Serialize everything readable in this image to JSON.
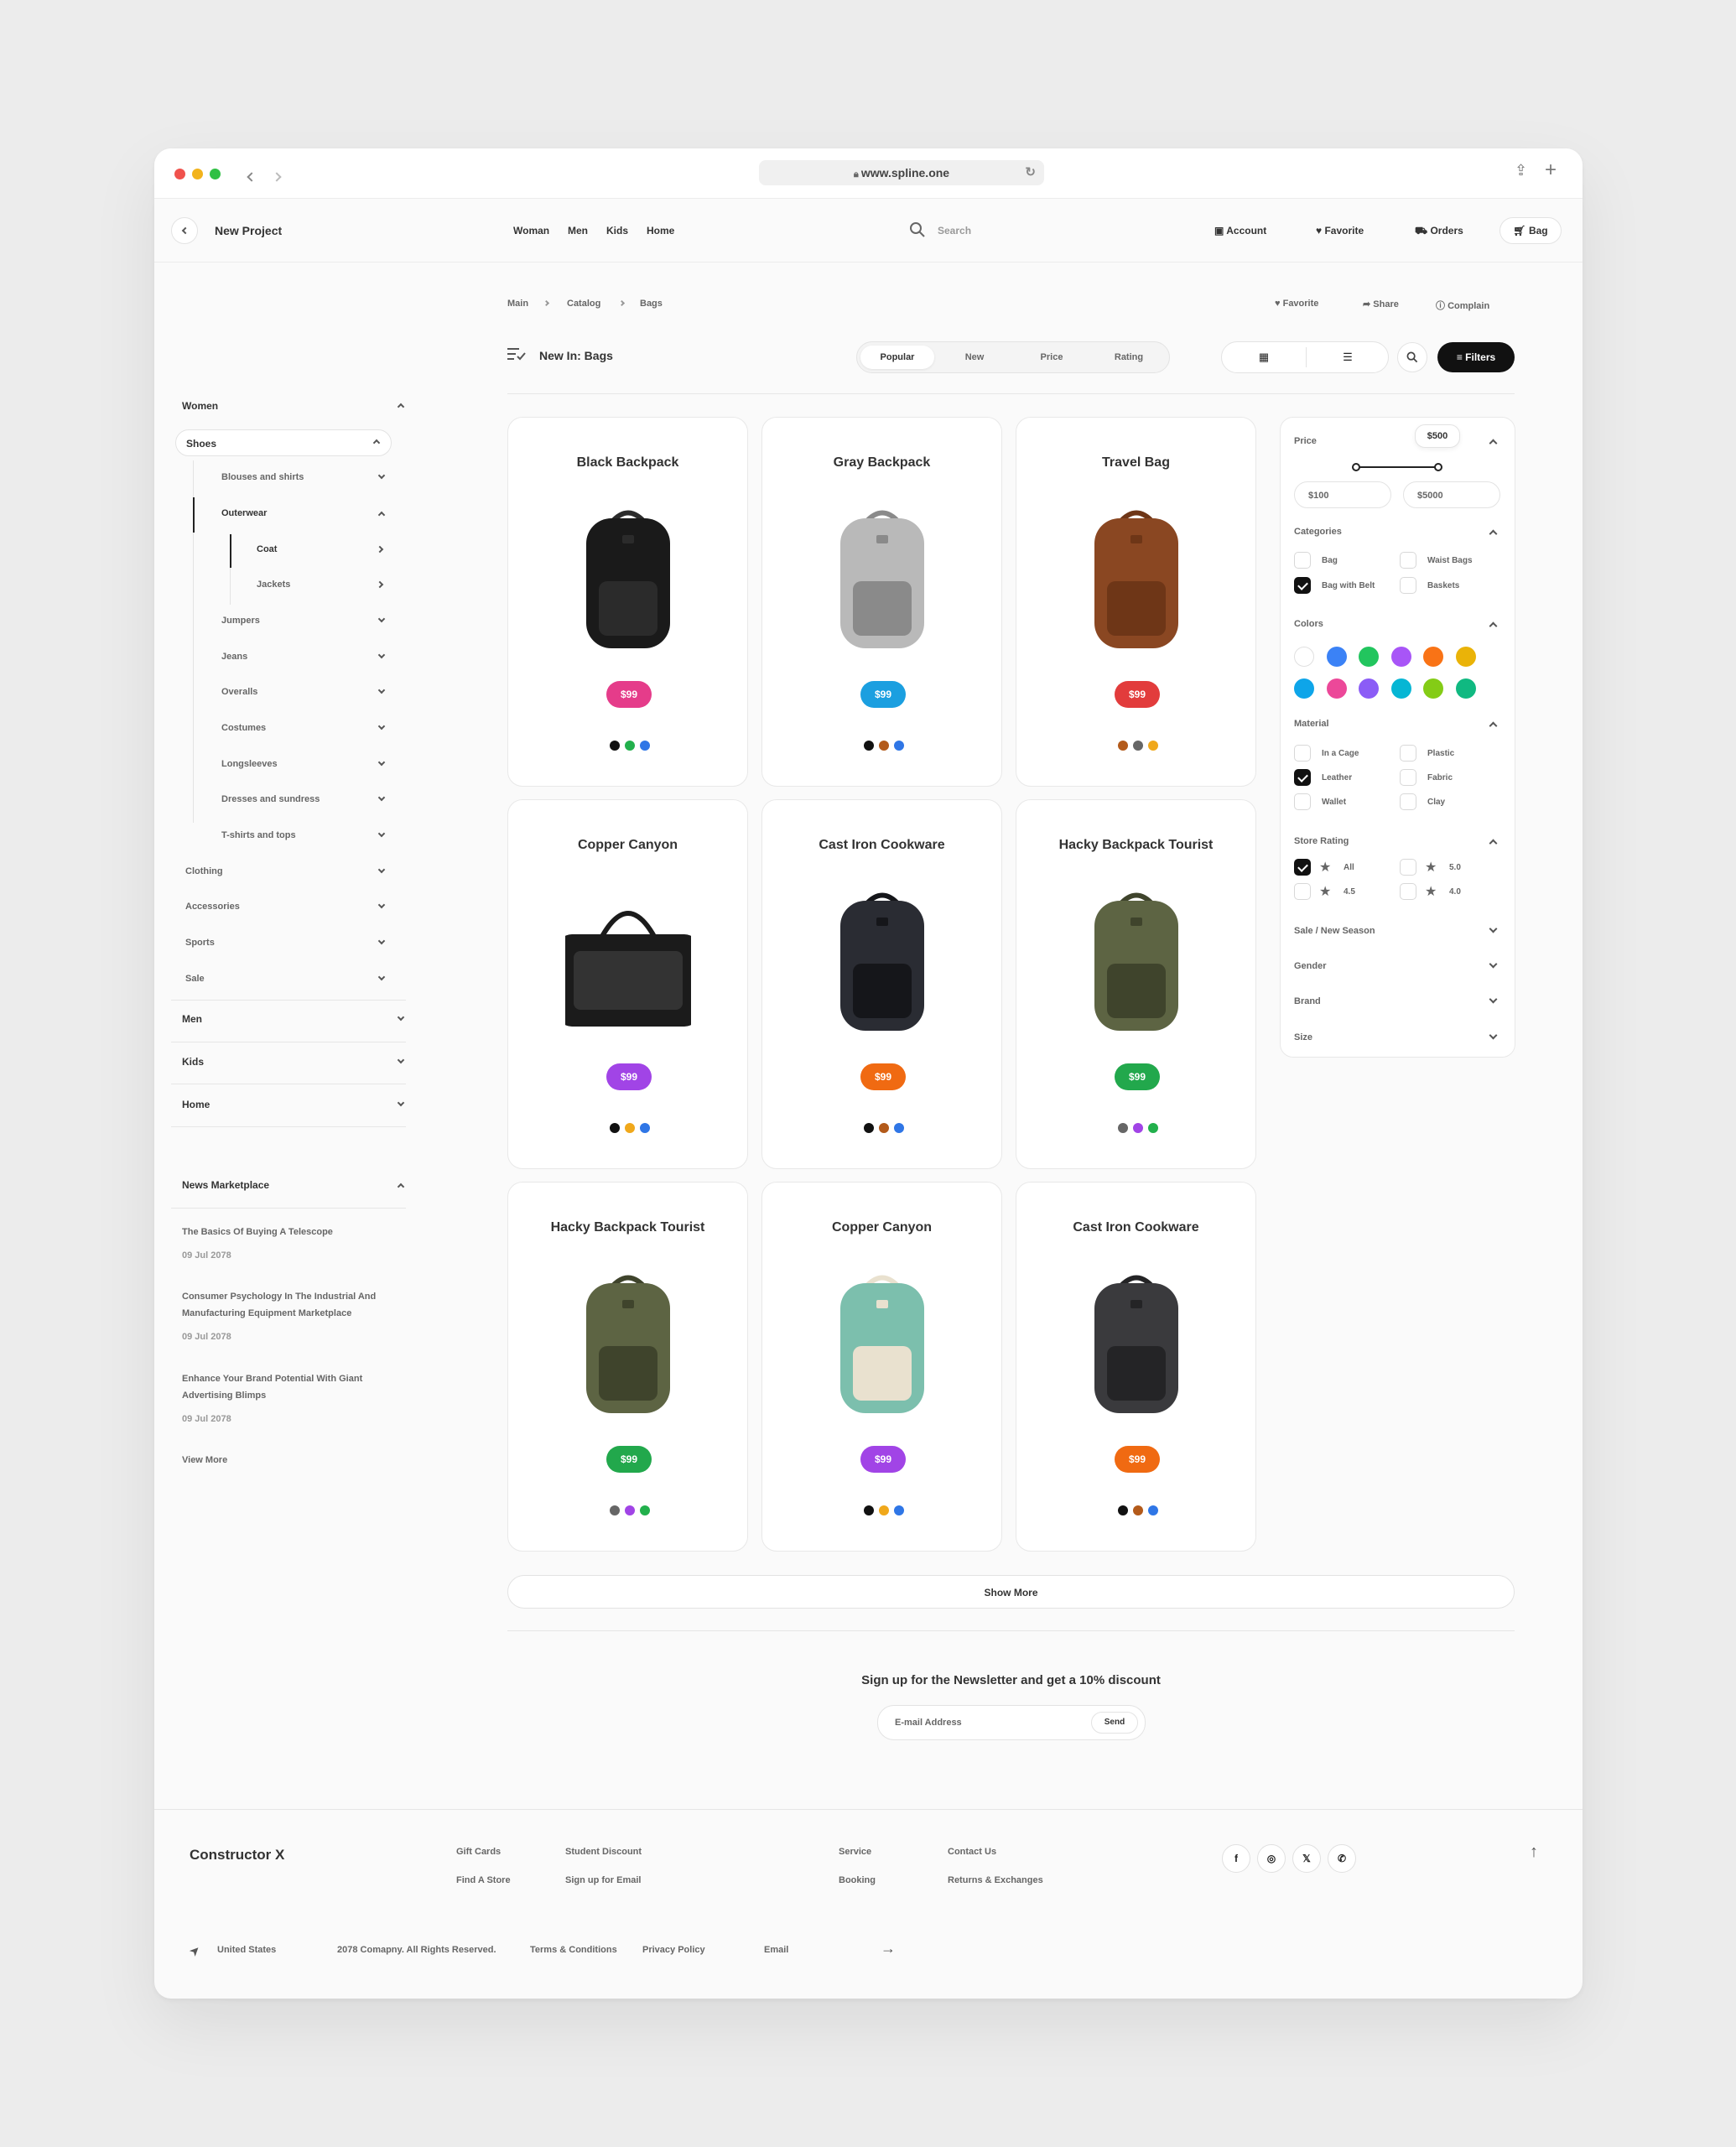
{
  "browser": {
    "url": "www.spline.one"
  },
  "appbar": {
    "back_label": "New Project",
    "nav": [
      "Woman",
      "Men",
      "Kids",
      "Home"
    ],
    "search_placeholder": "Search",
    "account": "Account",
    "favorite": "Favorite",
    "orders": "Orders",
    "bag": "Bag"
  },
  "sidebar": {
    "women": "Women",
    "shoes": "Shoes",
    "blouses": "Blouses and shirts",
    "outerwear": "Outerwear",
    "coat": "Coat",
    "jackets": "Jackets",
    "sub": [
      "Jumpers",
      "Jeans",
      "Overalls",
      "Costumes",
      "Longsleeves",
      "Dresses and sundress",
      "T-shirts and tops"
    ],
    "more": [
      "Clothing",
      "Accessories",
      "Sports",
      "Sale"
    ],
    "top": [
      "Men",
      "Kids",
      "Home"
    ],
    "news_title": "News Marketplace",
    "news": [
      {
        "l1": "The Basics Of Buying A Telescope",
        "l2": "",
        "date": "09 Jul 2078"
      },
      {
        "l1": "Consumer Psychology In The Industrial And",
        "l2": "Manufacturing Equipment Marketplace",
        "date": "09 Jul 2078"
      },
      {
        "l1": "Enhance Your Brand Potential With Giant",
        "l2": "Advertising Blimps",
        "date": "09 Jul 2078"
      }
    ],
    "view_more": "View More"
  },
  "breadcrumb": [
    "Main",
    "Catalog",
    "Bags"
  ],
  "actions": {
    "favorite": "Favorite",
    "share": "Share",
    "complain": "Complain"
  },
  "heading": "New In: Bags",
  "sort_tabs": [
    "Popular",
    "New",
    "Price",
    "Rating"
  ],
  "filters_button": "Filters",
  "products": [
    {
      "name": "Black Backpack",
      "price": "$99",
      "price_color": "#e53c8a",
      "swatches": [
        "#111111",
        "#22b04c",
        "#2f76e6"
      ]
    },
    {
      "name": "Gray Backpack",
      "price": "$99",
      "price_color": "#1b9fe0",
      "swatches": [
        "#111111",
        "#b35a1a",
        "#2f76e6"
      ]
    },
    {
      "name": "Travel Bag",
      "price": "$99",
      "price_color": "#e23c3c",
      "swatches": [
        "#b35a1a",
        "#666666",
        "#f0a81b"
      ]
    },
    {
      "name": "Copper Canyon",
      "price": "$99",
      "price_color": "#a144e6",
      "swatches": [
        "#111111",
        "#f0a81b",
        "#2f76e6"
      ]
    },
    {
      "name": "Cast Iron Cookware",
      "price": "$99",
      "price_color": "#f06a12",
      "swatches": [
        "#111111",
        "#b35a1a",
        "#2f76e6"
      ]
    },
    {
      "name": "Hacky Backpack Tourist",
      "price": "$99",
      "price_color": "#22a84c",
      "swatches": [
        "#666666",
        "#a144e6",
        "#22b04c"
      ]
    },
    {
      "name": "Hacky Backpack Tourist",
      "price": "$99",
      "price_color": "#22a84c",
      "swatches": [
        "#666666",
        "#a144e6",
        "#22b04c"
      ]
    },
    {
      "name": "Copper Canyon",
      "price": "$99",
      "price_color": "#a144e6",
      "swatches": [
        "#111111",
        "#f0a81b",
        "#2f76e6"
      ]
    },
    {
      "name": "Cast Iron Cookware",
      "price": "$99",
      "price_color": "#f06a12",
      "swatches": [
        "#111111",
        "#b35a1a",
        "#2f76e6"
      ]
    }
  ],
  "show_more": "Show More",
  "filters": {
    "price_title": "Price",
    "price_tooltip": "$500",
    "price_min": "$100",
    "price_max": "$5000",
    "categories_title": "Categories",
    "categories": [
      {
        "label": "Bag",
        "checked": false
      },
      {
        "label": "Waist Bags",
        "checked": false
      },
      {
        "label": "Bag with Belt",
        "checked": true
      },
      {
        "label": "Baskets",
        "checked": false
      }
    ],
    "colors_title": "Colors",
    "colors": [
      "#ffffff",
      "#3b82f6",
      "#22c55e",
      "#a855f7",
      "#f97316",
      "#eab308",
      "#0ea5e9",
      "#ec4899",
      "#8b5cf6",
      "#06b6d4",
      "#84cc16",
      "#10b981"
    ],
    "material_title": "Material",
    "materials": [
      {
        "label": "In a Cage",
        "checked": false
      },
      {
        "label": "Plastic",
        "checked": false
      },
      {
        "label": "Leather",
        "checked": true
      },
      {
        "label": "Fabric",
        "checked": false
      },
      {
        "label": "Wallet",
        "checked": false
      },
      {
        "label": "Clay",
        "checked": false
      }
    ],
    "rating_title": "Store Rating",
    "ratings": [
      {
        "label": "All",
        "checked": true
      },
      {
        "label": "5.0",
        "checked": false
      },
      {
        "label": "4.5",
        "checked": false
      },
      {
        "label": "4.0",
        "checked": false
      }
    ],
    "collapsed": [
      "Sale / New Season",
      "Gender",
      "Brand",
      "Size"
    ]
  },
  "newsletter": {
    "title": "Sign up for the Newsletter and get a 10% discount",
    "placeholder": "E-mail Address",
    "send": "Send"
  },
  "footer": {
    "brand": "Constructor X",
    "col1": [
      "Gift Cards",
      "Find A Store"
    ],
    "col2": [
      "Student Discount",
      "Sign up for Email"
    ],
    "col3": [
      "Service",
      "Booking"
    ],
    "col4": [
      "Contact Us",
      "Returns & Exchanges"
    ],
    "social": [
      "f",
      "◎",
      "𝕏",
      "✆"
    ],
    "country": "United States",
    "copyright": "2078 Comapny. All Rights Reserved.",
    "terms": "Terms & Conditions",
    "privacy": "Privacy Policy",
    "email": "Email"
  }
}
